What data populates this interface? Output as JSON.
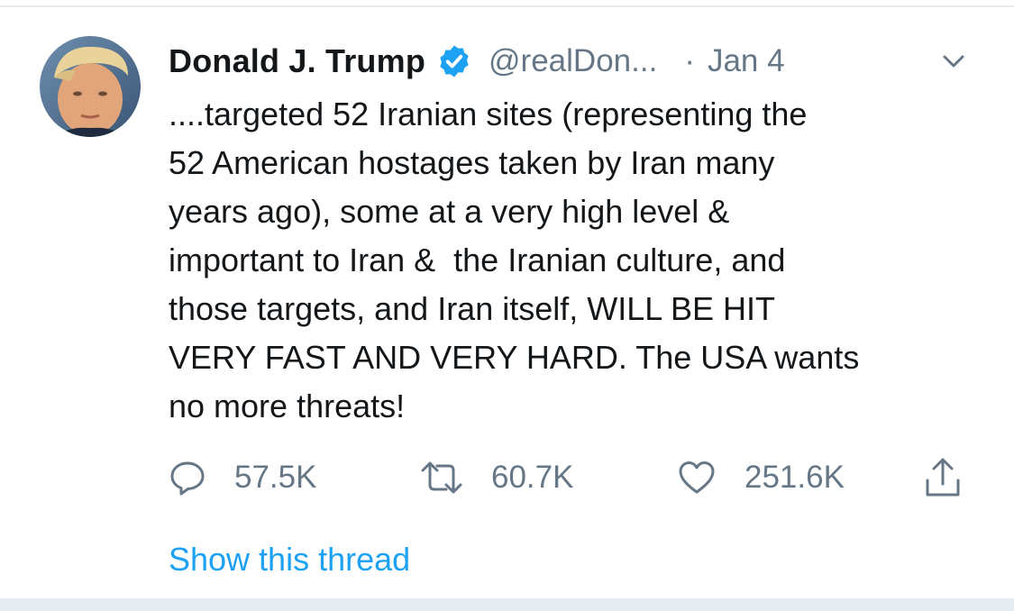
{
  "tweet": {
    "author_name": "Donald J. Trump",
    "handle": "@realDon...",
    "separator": "·",
    "date": "Jan 4",
    "verified": true,
    "text_lines": [
      "....targeted 52 Iranian sites (representing the",
      "52 American hostages taken by Iran many",
      "years ago), some at a very high level &",
      "important to Iran &  the Iranian culture, and",
      "those targets, and Iran itself, WILL BE HIT",
      "VERY FAST AND VERY HARD. The USA wants",
      "no more threats!"
    ]
  },
  "actions": {
    "reply_count": "57.5K",
    "retweet_count": "60.7K",
    "like_count": "251.6K"
  },
  "thread_link": "Show this thread",
  "icons": {
    "reply": "speech-bubble-icon",
    "retweet": "retweet-arrows-icon",
    "like": "heart-icon",
    "share": "share-upload-icon",
    "menu": "chevron-down-icon",
    "verified": "verified-badge-icon"
  },
  "colors": {
    "text": "#14171a",
    "secondary": "#657786",
    "accent": "#1da1f2",
    "divider": "#e6ecf0"
  }
}
